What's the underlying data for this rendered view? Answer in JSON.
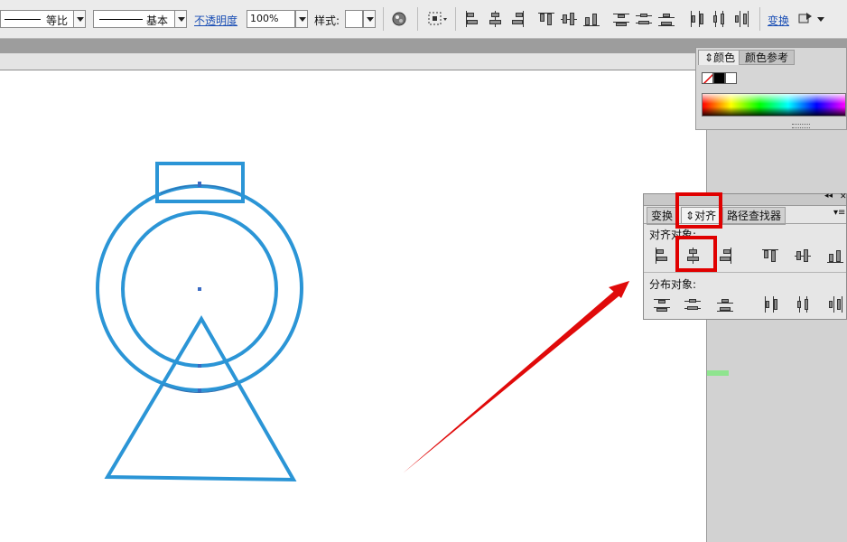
{
  "toolbar": {
    "stroke_profile_label": "等比",
    "brush_label": "基本",
    "opacity_label": "不透明度",
    "opacity_value": "100%",
    "style_label": "样式:",
    "transform_link": "变换",
    "icons": [
      "recolor-icon",
      "isolate-icon",
      "align-left-icon",
      "align-horizontal-center-icon",
      "align-right-icon",
      "align-top-icon",
      "align-vertical-center-icon",
      "align-bottom-icon",
      "distribute-top-icon",
      "distribute-vertical-center-icon",
      "distribute-bottom-icon",
      "distribute-left-icon",
      "distribute-horizontal-center-icon",
      "distribute-right-icon",
      "arrange-icon"
    ]
  },
  "color_panel": {
    "tabs": [
      {
        "label": "颜色",
        "active": true
      },
      {
        "label": "颜色参考",
        "active": false
      }
    ]
  },
  "align_panel": {
    "tabs": [
      {
        "label": "变换",
        "active": false
      },
      {
        "label": "对齐",
        "active": true
      },
      {
        "label": "路径查找器",
        "active": false
      }
    ],
    "align_objects_label": "对齐对象:",
    "distribute_objects_label": "分布对象:"
  },
  "colors": {
    "shape_stroke": "#2b95d6",
    "highlight": "#e00000",
    "arrow": "#e00a0a",
    "canvas": "#ffffff"
  }
}
